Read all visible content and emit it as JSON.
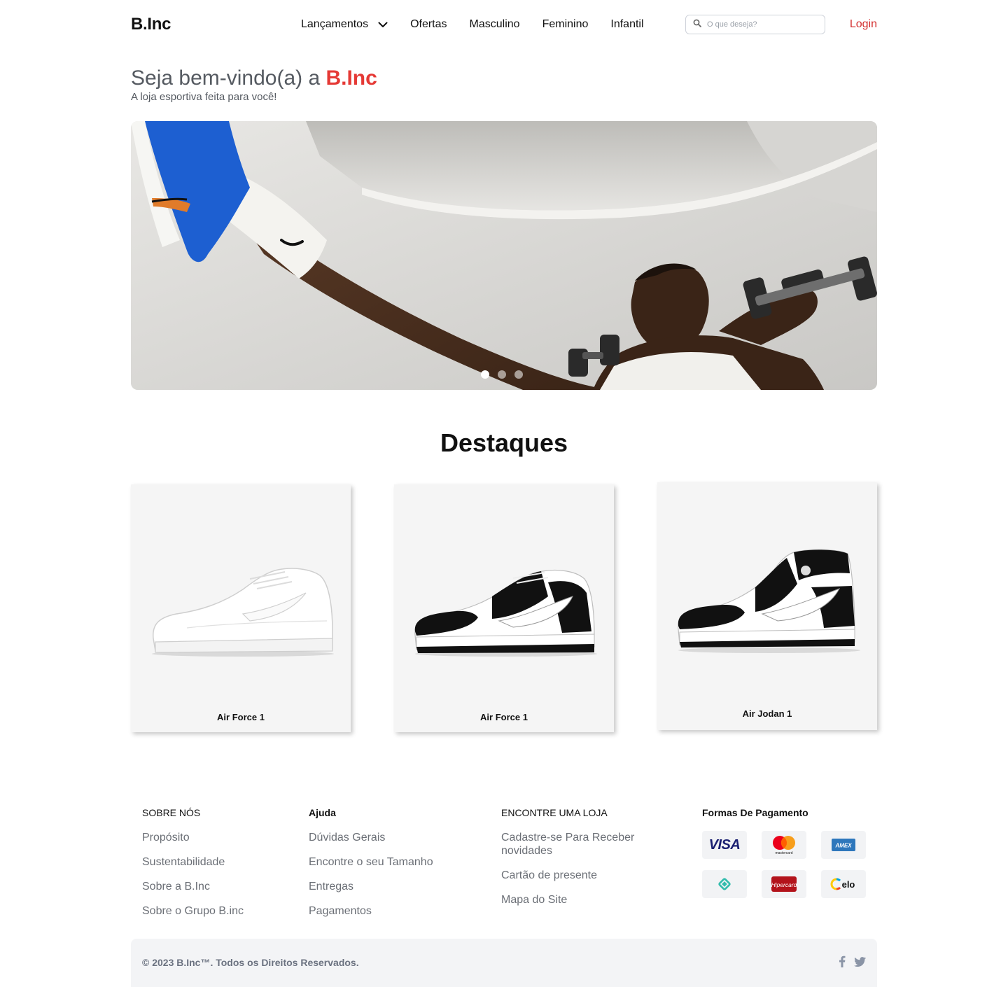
{
  "header": {
    "logo": "B.Inc",
    "nav": [
      {
        "label": "Lançamentos",
        "has_dropdown": true
      },
      {
        "label": "Ofertas"
      },
      {
        "label": "Masculino"
      },
      {
        "label": "Feminino"
      },
      {
        "label": "Infantil"
      }
    ],
    "search_placeholder": "O que deseja?",
    "login": "Login"
  },
  "welcome": {
    "title_prefix": "Seja bem-vindo(a) a ",
    "title_brand": "B.Inc",
    "subtitle": "A loja esportiva feita para você!"
  },
  "hero": {
    "slide_count": 3,
    "active_slide": 1
  },
  "highlights": {
    "title": "Destaques",
    "products": [
      {
        "name": "Air Force 1"
      },
      {
        "name": "Air Force 1"
      },
      {
        "name": "Air Jodan 1"
      }
    ]
  },
  "footer": {
    "columns": [
      {
        "heading": "SOBRE NÓS",
        "links": [
          "Propósito",
          "Sustentabilidade",
          "Sobre a B.Inc",
          "Sobre o Grupo B.inc"
        ]
      },
      {
        "heading": "Ajuda",
        "links": [
          "Dúvidas Gerais",
          "Encontre o seu Tamanho",
          "Entregas",
          "Pagamentos"
        ]
      },
      {
        "heading": "ENCONTRE UMA LOJA",
        "links": [
          "Cadastre-se Para Receber novidades",
          "Cartão de presente",
          "Mapa do Site"
        ]
      }
    ],
    "payments": {
      "heading": "Formas De Pagamento",
      "methods": [
        "Visa",
        "Mastercard",
        "American Express",
        "Pix",
        "Hipercard",
        "Elo"
      ],
      "visa_label": "VISA",
      "mastercard_label": "mastercard",
      "amex_label": "AMEX",
      "hipercard_label": "Hipercard",
      "elo_label": "elo"
    },
    "copyright": "© 2023 B.Inc™. Todos os Direitos Reservados.",
    "social": [
      "facebook-icon",
      "twitter-icon"
    ]
  },
  "colors": {
    "brand_red": "#e53935",
    "login_red": "#d32f2f",
    "text_gray": "#6b6f76"
  }
}
